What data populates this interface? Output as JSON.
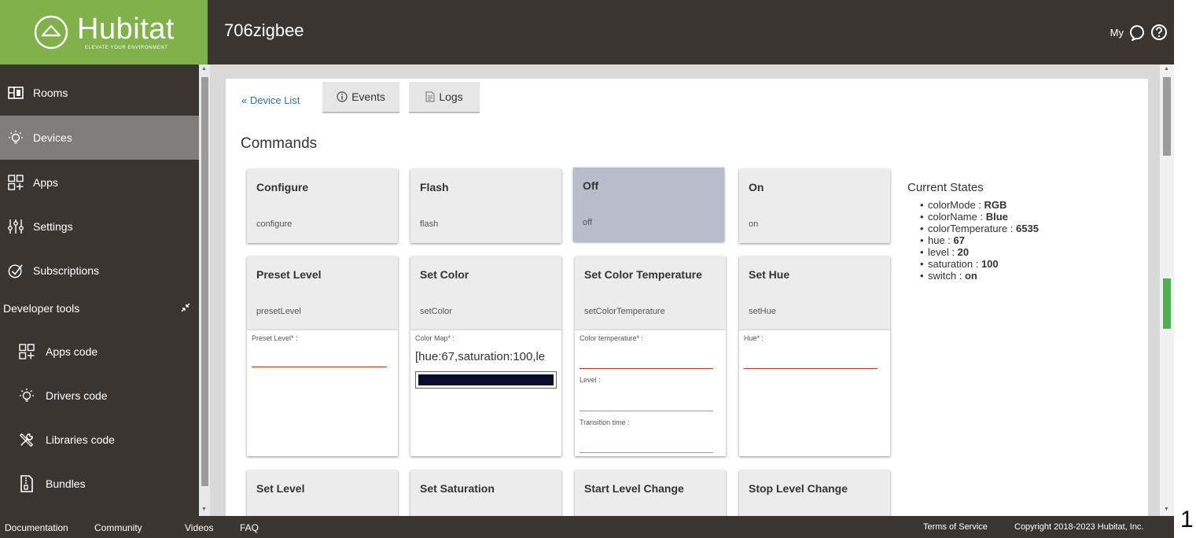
{
  "brand": {
    "name": "Hubitat",
    "tagline": "ELEVATE YOUR ENVIRONMENT",
    "accent": "#81b14a"
  },
  "header": {
    "title": "706zigbee",
    "my_label": "My",
    "chat_icon": "chat-bubble-icon",
    "help_icon": "help-circle-icon"
  },
  "sidebar": {
    "items": [
      {
        "label": "Rooms",
        "icon": "rooms-icon"
      },
      {
        "label": "Devices",
        "icon": "bulb-icon",
        "active": true
      },
      {
        "label": "Apps",
        "icon": "apps-icon"
      },
      {
        "label": "Settings",
        "icon": "sliders-icon"
      },
      {
        "label": "Subscriptions",
        "icon": "check-circle-icon"
      }
    ],
    "developer_tools": {
      "label": "Developer tools",
      "items": [
        {
          "label": "Apps code",
          "icon": "apps-icon"
        },
        {
          "label": "Drivers code",
          "icon": "bulb-icon"
        },
        {
          "label": "Libraries code",
          "icon": "tools-icon"
        },
        {
          "label": "Bundles",
          "icon": "zip-icon"
        }
      ]
    }
  },
  "tabs": {
    "device_list": "« Device List",
    "events": "Events",
    "logs": "Logs"
  },
  "commands_heading": "Commands",
  "commands": {
    "configure": {
      "name": "Configure",
      "method": "configure"
    },
    "flash": {
      "name": "Flash",
      "method": "flash"
    },
    "off": {
      "name": "Off",
      "method": "off"
    },
    "on": {
      "name": "On",
      "method": "on"
    },
    "preset_level": {
      "name": "Preset Level",
      "method": "presetLevel",
      "field": "Preset Level* :"
    },
    "set_color": {
      "name": "Set Color",
      "method": "setColor",
      "field": "Color Map* :",
      "value": "[hue:67,saturation:100,le"
    },
    "set_color_temperature": {
      "name": "Set Color Temperature",
      "method": "setColorTemperature",
      "field": "Color temperature* :",
      "field2": "Level :",
      "field3": "Transition time :"
    },
    "set_hue": {
      "name": "Set Hue",
      "method": "setHue",
      "field": "Hue* :"
    },
    "set_level": {
      "name": "Set Level"
    },
    "set_saturation": {
      "name": "Set Saturation"
    },
    "start_level_change": {
      "name": "Start Level Change"
    },
    "stop_level_change": {
      "name": "Stop Level Change"
    }
  },
  "current_states": {
    "heading": "Current States",
    "items": [
      {
        "key": "colorMode :",
        "value": "RGB"
      },
      {
        "key": "colorName :",
        "value": "Blue"
      },
      {
        "key": "colorTemperature :",
        "value": "6535"
      },
      {
        "key": "hue :",
        "value": "67"
      },
      {
        "key": "level :",
        "value": "20"
      },
      {
        "key": "saturation :",
        "value": "100"
      },
      {
        "key": "switch :",
        "value": "on"
      }
    ]
  },
  "footer": {
    "links": [
      "Documentation",
      "Community",
      "Videos",
      "FAQ"
    ],
    "terms": "Terms of Service",
    "copyright": "Copyright 2018-2023 Hubitat, Inc."
  },
  "page_number": "1"
}
